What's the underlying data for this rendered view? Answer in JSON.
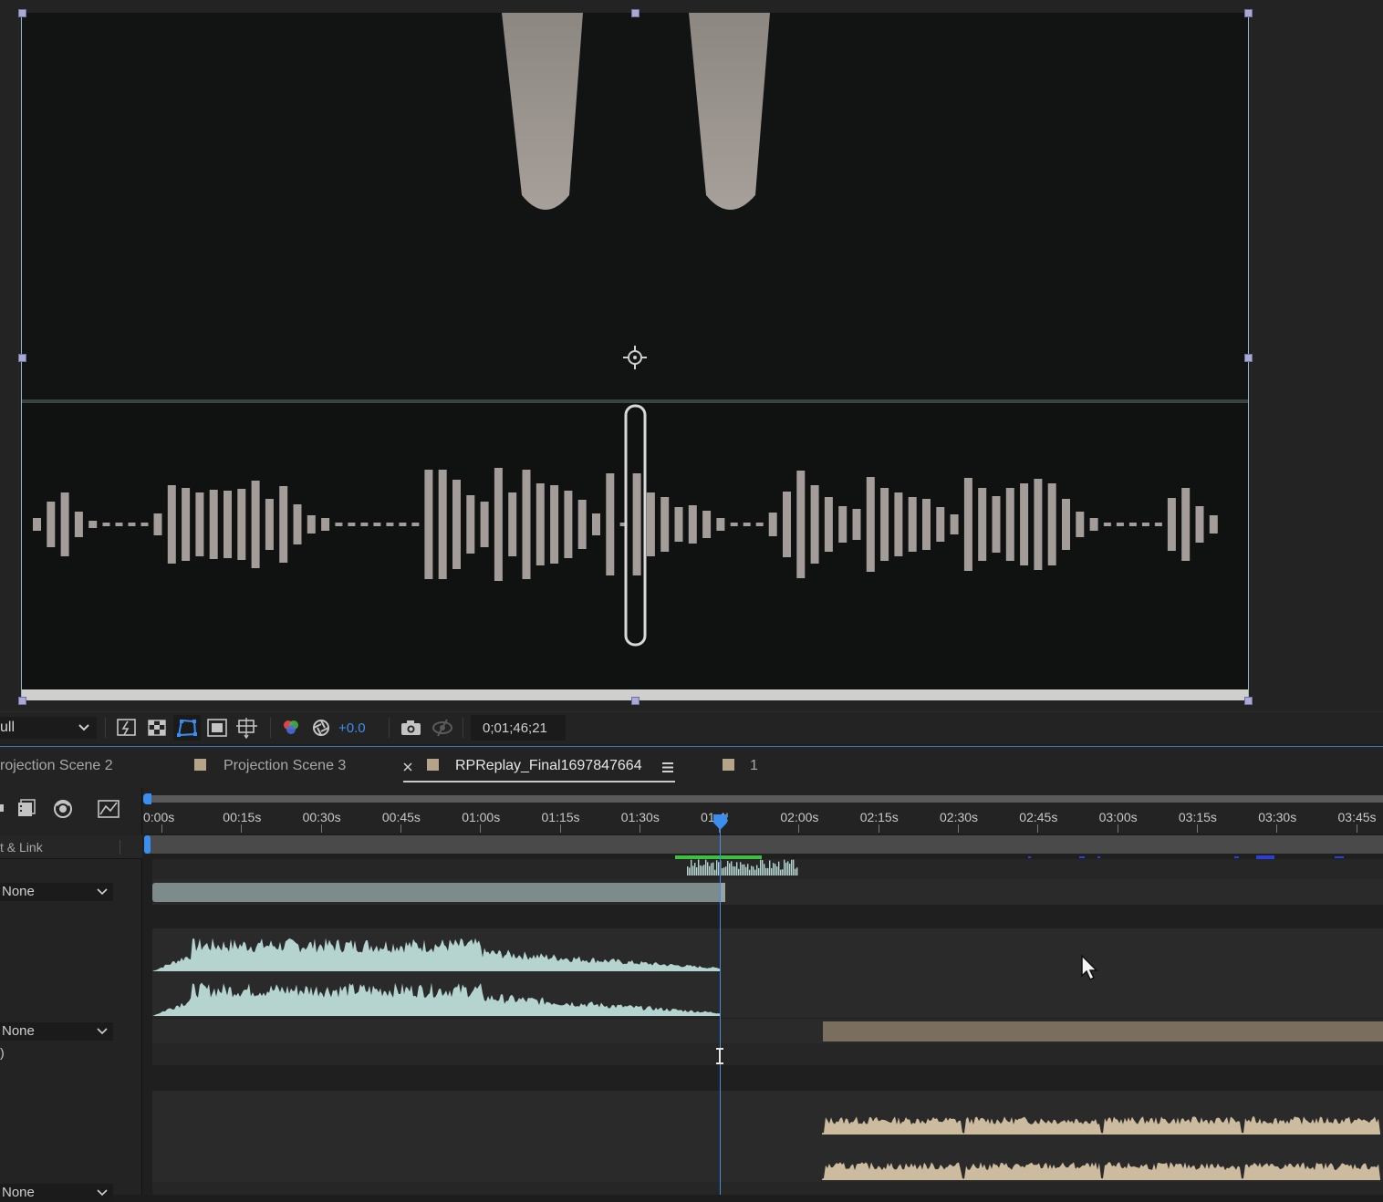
{
  "viewer": {
    "resolution_value": "ull",
    "exposure_value": "+0.0",
    "timecode": "0;01;46;21"
  },
  "icons": {
    "dropdown": "chevron-down-icon",
    "fast_previews": "fast-previews-icon",
    "transparency_grid": "transparency-grid-icon",
    "mask_visibility": "mask-path-visibility-icon",
    "region_of_interest": "region-of-interest-icon",
    "grid_guides": "grid-guides-icon",
    "channel": "rgb-channel-icon",
    "reset_exposure": "reset-exposure-icon",
    "snapshot": "camera-icon",
    "show_snapshot": "show-snapshot-icon",
    "anchor_point": "anchor-point-icon",
    "tab_menu": "hamburger-menu-icon",
    "close_tab": "close-icon"
  },
  "tabs": [
    {
      "label": "rojection Scene 2",
      "active": false
    },
    {
      "label": "Projection Scene 3",
      "active": false
    },
    {
      "label": "RPReplay_Final1697847664",
      "active": true
    },
    {
      "label": "1",
      "active": false
    }
  ],
  "timeline": {
    "header_label": "t & Link",
    "ruler_labels": [
      "0:00s",
      "00:15s",
      "00:30s",
      "00:45s",
      "01:00s",
      "01:15s",
      "01:30s",
      "01:45s",
      "02:00s",
      "02:15s",
      "02:30s",
      "02:45s",
      "03:00s",
      "03:15s",
      "03:30s",
      "03:45s"
    ],
    "parent_dropdowns": [
      "None",
      "None",
      "None"
    ],
    "row_fragment": ")"
  },
  "colors": {
    "accent": "#3b8ef0",
    "audio_wave": "#b5d4d0",
    "audio_wave_2": "#cdbba0",
    "layer_bar": "#7d8b8a",
    "layer_bar_2": "#7a6e5e",
    "work_area_green": "#3fbf3f"
  }
}
